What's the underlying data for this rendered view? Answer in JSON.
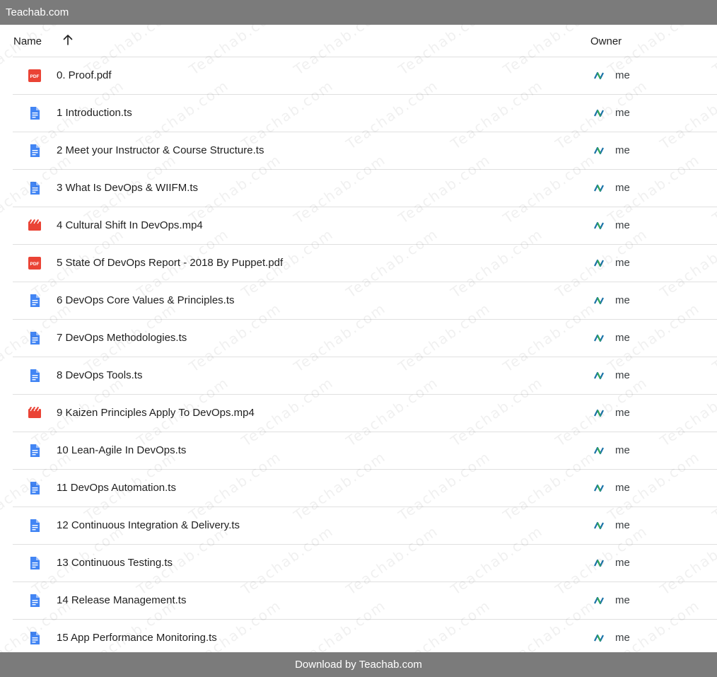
{
  "topbar": {
    "brand": "Teachab.com"
  },
  "header": {
    "name_label": "Name",
    "owner_label": "Owner",
    "sort_icon": "arrow-up-icon"
  },
  "colors": {
    "pdf": "#ea4335",
    "doc": "#4285f4",
    "video": "#ea4335",
    "bar": "#7b7b7b"
  },
  "files": [
    {
      "name": "0. Proof.pdf",
      "type": "pdf",
      "owner": "me"
    },
    {
      "name": "1 Introduction.ts",
      "type": "doc",
      "owner": "me"
    },
    {
      "name": "2 Meet your Instructor & Course Structure.ts",
      "type": "doc",
      "owner": "me"
    },
    {
      "name": "3 What Is DevOps & WIIFM.ts",
      "type": "doc",
      "owner": "me"
    },
    {
      "name": "4 Cultural Shift In DevOps.mp4",
      "type": "video",
      "owner": "me"
    },
    {
      "name": "5 State Of DevOps Report - 2018 By Puppet.pdf",
      "type": "pdf",
      "owner": "me"
    },
    {
      "name": "6 DevOps Core Values & Principles.ts",
      "type": "doc",
      "owner": "me"
    },
    {
      "name": "7 DevOps Methodologies.ts",
      "type": "doc",
      "owner": "me"
    },
    {
      "name": "8 DevOps Tools.ts",
      "type": "doc",
      "owner": "me"
    },
    {
      "name": "9 Kaizen Principles Apply To DevOps.mp4",
      "type": "video",
      "owner": "me"
    },
    {
      "name": "10 Lean-Agile In DevOps.ts",
      "type": "doc",
      "owner": "me"
    },
    {
      "name": "11 DevOps Automation.ts",
      "type": "doc",
      "owner": "me"
    },
    {
      "name": "12 Continuous Integration & Delivery.ts",
      "type": "doc",
      "owner": "me"
    },
    {
      "name": "13 Continuous Testing.ts",
      "type": "doc",
      "owner": "me"
    },
    {
      "name": "14 Release Management.ts",
      "type": "doc",
      "owner": "me"
    },
    {
      "name": "15 App Performance Monitoring.ts",
      "type": "doc",
      "owner": "me"
    }
  ],
  "footer": {
    "text": "Download by Teachab.com"
  },
  "watermark": {
    "text": "Teachab.com"
  }
}
